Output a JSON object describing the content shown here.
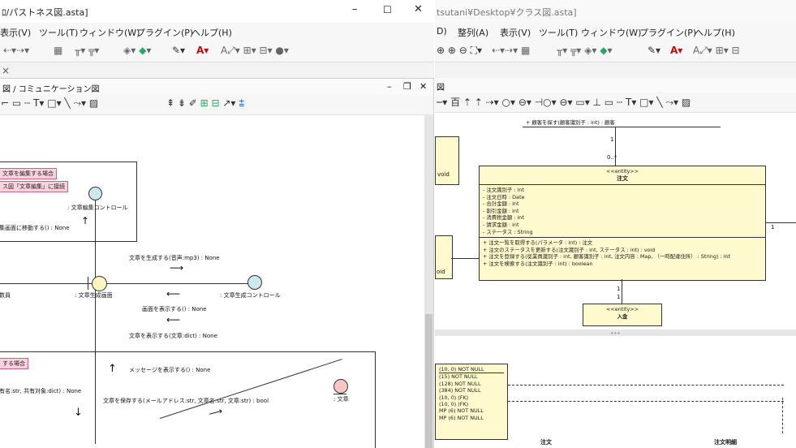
{
  "left_window": {
    "title": "ﾛ/パストネス図.asta]",
    "menu": [
      "表示(V)",
      "ツール(T)",
      "ウィンドウ(W)",
      "プラグイン(P)",
      "ヘルプ(H)"
    ],
    "window_controls": {
      "minimize": "–",
      "maximize": "☐",
      "close": "✕"
    },
    "tab_close": "×",
    "diagram_window": {
      "title": "図 / コミュニケーション図",
      "controls": {
        "minimize": "–",
        "restore": "❐",
        "close": "✕"
      }
    },
    "diagram": {
      "notes": [
        "文章を編集する場合",
        "ス図「文章編集」に接続",
        "する場合"
      ],
      "objects": [
        ": 文章編集コントロール",
        ": 文章生成画面",
        ": 文章生成コントロール",
        ": 文章"
      ],
      "actor_label": "数員",
      "messages": [
        "集画面に移動する() : None",
        "文章を生成する(音声:mp3) : None",
        "画面を表示する() : None",
        "文章を表示する(文章:dict) : None",
        "メッセージを表示する() : None",
        "有名:str, 共有対象:dict) : None",
        "文章を保存する(メールアドレス:str, 文章名:str, 文章:str) : bool"
      ]
    }
  },
  "right_window": {
    "title": "tsutani¥Desktop¥クラス図.asta]",
    "menu": [
      "D)",
      "整列(A)",
      "表示(V)",
      "ツール(T)",
      "ウィンドウ(W)",
      "プラグイン(P)",
      "ヘルプ(H)"
    ],
    "class_diagram": {
      "top_operation": "+ 顧客を探す(顧客識別子 : int) : 顧客",
      "left_partial_1": "void",
      "left_partial_2": "oid",
      "multiplicity_top": [
        "1",
        "0..*"
      ],
      "multiplicity_bottom": [
        "1",
        "1"
      ],
      "multiplicity_right": "1",
      "main_class": {
        "stereotype": "<<entity>>",
        "name": "注文",
        "attributes": [
          "- 注文識別子 : int",
          "- 注文日時 : Date",
          "- 合計金額 : int",
          "- 割引金額 : int",
          "- 消費税金額 : int",
          "- 請求金額 : int",
          "- ステータス : String"
        ],
        "operations": [
          "+ 注文一覧を取得する(パラメータ : int) : 注文",
          "+ 注文のステータスを更新する(注文識別子 : int, ステータス : int) : void",
          "+ 注文を登録する(従業員識別子 : int, 顧客識別子 : int, 注文内容 : Map, （一時配達住所） : String) : int",
          "+ 注文を検索する(注文識別子 : int) : boolean"
        ]
      },
      "lower_class": {
        "stereotype": "<<entity>>",
        "name": "入金"
      }
    },
    "er_diagram": {
      "column_rows": [
        "(10, 0)  NOT NULL",
        "(15)  NOT NULL",
        "(128)  NOT NULL",
        "(384)  NOT NULL",
        "(10, 0)         (FK)",
        "(10, 0)         (FK)",
        "MP (6)  NOT NULL",
        "MP (6)  NOT NULL"
      ],
      "table_labels": [
        "注文",
        "注文明細"
      ]
    },
    "splitter_grip": "•••"
  }
}
